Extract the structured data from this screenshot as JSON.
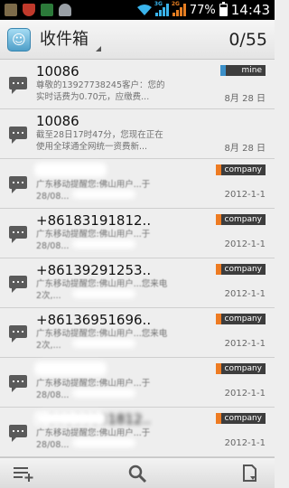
{
  "status_bar": {
    "network_1": "3G",
    "network_2": "2G",
    "battery_text": "77%",
    "battery_level": 0.77,
    "time": "14:43"
  },
  "action_bar": {
    "title": "收件箱",
    "count": "0/55"
  },
  "messages": [
    {
      "sender": "10086",
      "preview": "尊敬的13927738245客户：您的实时话费为0.70元，应缴费...",
      "date": "8月 28 日",
      "tag": "mine",
      "tag_color": "#3b8fc8",
      "sender_obscured": false,
      "preview_obscured": false
    },
    {
      "sender": "10086",
      "preview": "截至28日17时47分，您现在正在使用全球通全网统一资费新...",
      "date": "8月 28 日",
      "tag": "",
      "tag_color": "",
      "sender_obscured": false,
      "preview_obscured": false
    },
    {
      "sender": "",
      "preview": "广东移动提醒您:佛山用户...于28/08...",
      "date": "2012-1-1",
      "tag": "company",
      "tag_color": "#ee7b22",
      "sender_obscured": true,
      "preview_obscured": true
    },
    {
      "sender": "+86183191812..",
      "preview": "广东移动提醒您:佛山用户...于28/08...",
      "date": "2012-1-1",
      "tag": "company",
      "tag_color": "#ee7b22",
      "sender_obscured": false,
      "preview_obscured": true
    },
    {
      "sender": "+86139291253..",
      "preview": "广东移动提醒您:佛山用户...您来电2次,...",
      "date": "2012-1-1",
      "tag": "company",
      "tag_color": "#ee7b22",
      "sender_obscured": false,
      "preview_obscured": true
    },
    {
      "sender": "+86136951696..",
      "preview": "广东移动提醒您:佛山用户...您来电2次,...",
      "date": "2012-1-1",
      "tag": "company",
      "tag_color": "#ee7b22",
      "sender_obscured": false,
      "preview_obscured": true
    },
    {
      "sender": "",
      "preview": "广东移动提醒您:佛山用户...于28/08...",
      "date": "2012-1-1",
      "tag": "company",
      "tag_color": "#ee7b22",
      "sender_obscured": true,
      "preview_obscured": true
    },
    {
      "sender": "+86133131812..",
      "preview": "广东移动提醒您:佛山用户...于28/08...",
      "date": "2012-1-1",
      "tag": "company",
      "tag_color": "#ee7b22",
      "sender_obscured": true,
      "preview_obscured": true
    }
  ],
  "bottom_bar": {
    "icons": [
      "compose-icon",
      "search-icon",
      "folder-menu-icon"
    ]
  }
}
